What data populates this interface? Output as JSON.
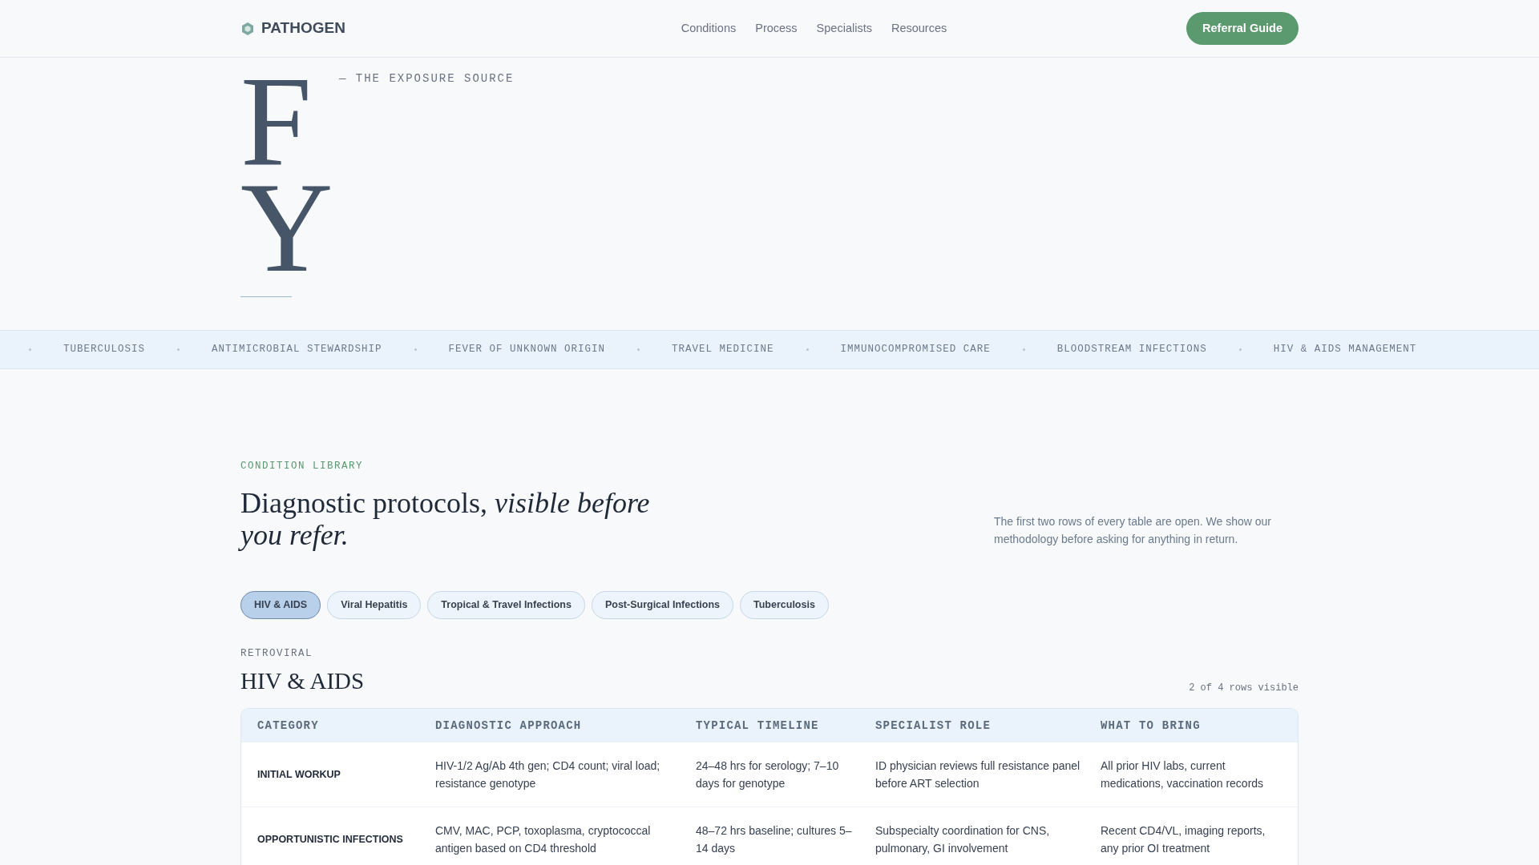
{
  "header": {
    "brand": "PATHOGEN",
    "nav": [
      "Conditions",
      "Process",
      "Specialists",
      "Resources"
    ],
    "cta": "Referral Guide"
  },
  "hero": {
    "letters": [
      "F",
      "Y"
    ],
    "tagline": "— THE EXPOSURE SOURCE"
  },
  "ticker": [
    "TUBERCULOSIS",
    "ANTIMICROBIAL STEWARDSHIP",
    "FEVER OF UNKNOWN ORIGIN",
    "TRAVEL MEDICINE",
    "IMMUNOCOMPROMISED CARE",
    "BLOODSTREAM INFECTIONS",
    "HIV & AIDS MANAGEMENT"
  ],
  "library": {
    "eyebrow": "CONDITION LIBRARY",
    "heading": "Diagnostic protocols, *visible before you refer.*",
    "intro": "The first two rows of every table are open. We show our methodology before asking for anything in return.",
    "tabs": [
      {
        "label": "HIV & AIDS",
        "selected": true
      },
      {
        "label": "Viral Hepatitis",
        "selected": false
      },
      {
        "label": "Tropical & Travel Infections",
        "selected": false
      },
      {
        "label": "Post-Surgical Infections",
        "selected": false
      },
      {
        "label": "Tuberculosis",
        "selected": false
      }
    ]
  },
  "condition": {
    "eyebrow": "RETROVIRAL",
    "title": "HIV & AIDS",
    "row_count": "2 of 4 rows visible",
    "table": {
      "columns": [
        "CATEGORY",
        "DIAGNOSTIC APPROACH",
        "TYPICAL TIMELINE",
        "SPECIALIST ROLE",
        "WHAT TO BRING"
      ],
      "rows": [
        [
          "INITIAL WORKUP",
          "HIV-1/2 Ag/Ab 4th gen; CD4 count; viral load; resistance genotype",
          "24–48 hrs for serology; 7–10 days for genotype",
          "ID physician reviews full resistance panel before ART selection",
          "All prior HIV labs, current medications, vaccination records"
        ],
        [
          "OPPORTUNISTIC INFECTIONS",
          "CMV, MAC, PCP, toxoplasma, cryptococcal antigen based on CD4 threshold",
          "48–72 hrs baseline; cultures 5–14 days",
          "Subspecialty coordination for CNS, pulmonary, GI involvement",
          "Recent CD4/VL, imaging reports, any prior OI treatment"
        ]
      ]
    }
  }
}
